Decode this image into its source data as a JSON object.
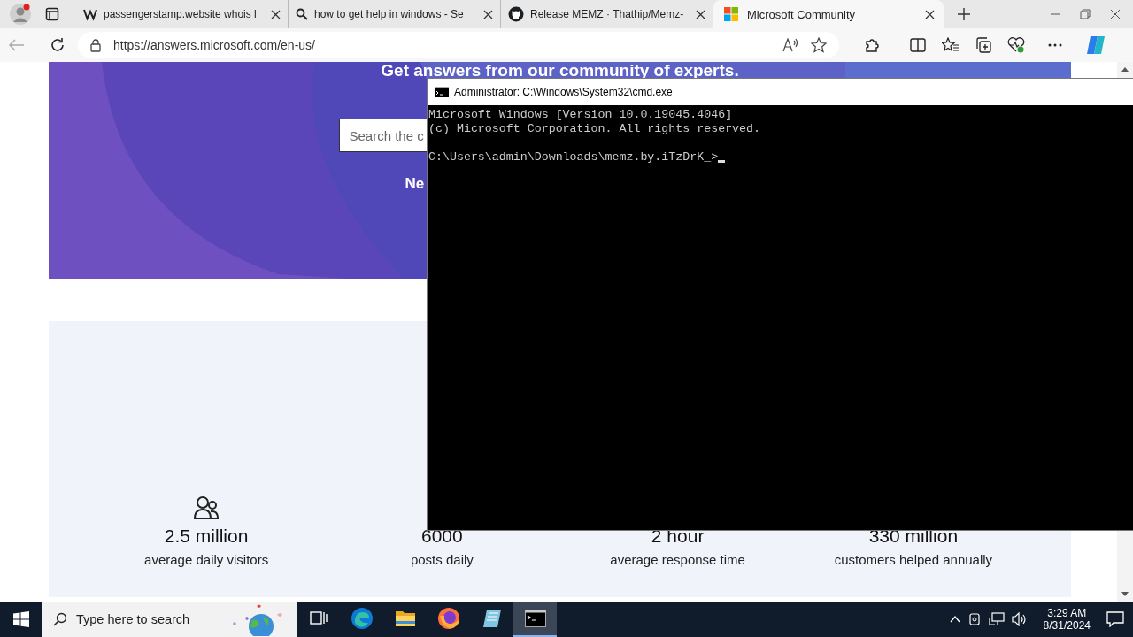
{
  "browser": {
    "tabs": [
      {
        "title": "passengerstamp.website whois l",
        "selected": false
      },
      {
        "title": "how to get help in windows - Se",
        "selected": false
      },
      {
        "title": "Release MEMZ · Thathip/Memz-",
        "selected": false
      },
      {
        "title": "Microsoft Community",
        "selected": true
      }
    ],
    "address": "https://answers.microsoft.com/en-us/"
  },
  "page": {
    "hero": {
      "heading": "Get answers from our community of experts.",
      "search_placeholder": "Search the c",
      "subtext": "Ne"
    },
    "stats": [
      {
        "value": "2.5 million",
        "label": "average daily visitors"
      },
      {
        "value": "6000",
        "label": "posts daily"
      },
      {
        "value": "2 hour",
        "label": "average response time"
      },
      {
        "value": "330 million",
        "label": "customers helped annually"
      }
    ]
  },
  "console": {
    "title": "Administrator: C:\\Windows\\System32\\cmd.exe",
    "output_lines": [
      "Microsoft Windows [Version 10.0.19045.4046]",
      "(c) Microsoft Corporation. All rights reserved."
    ],
    "prompt": "C:\\Users\\admin\\Downloads\\memz.by.iTzDrK_>"
  },
  "taskbar": {
    "search_placeholder": "Type here to search",
    "apps": [
      {
        "kind": "taskview",
        "selected": false
      },
      {
        "kind": "edge",
        "selected": false
      },
      {
        "kind": "explorer",
        "selected": false
      },
      {
        "kind": "firefox",
        "selected": false
      },
      {
        "kind": "notepad",
        "selected": false
      },
      {
        "kind": "cmd",
        "selected": true
      }
    ],
    "time": "3:29 AM",
    "date": "8/31/2024"
  }
}
